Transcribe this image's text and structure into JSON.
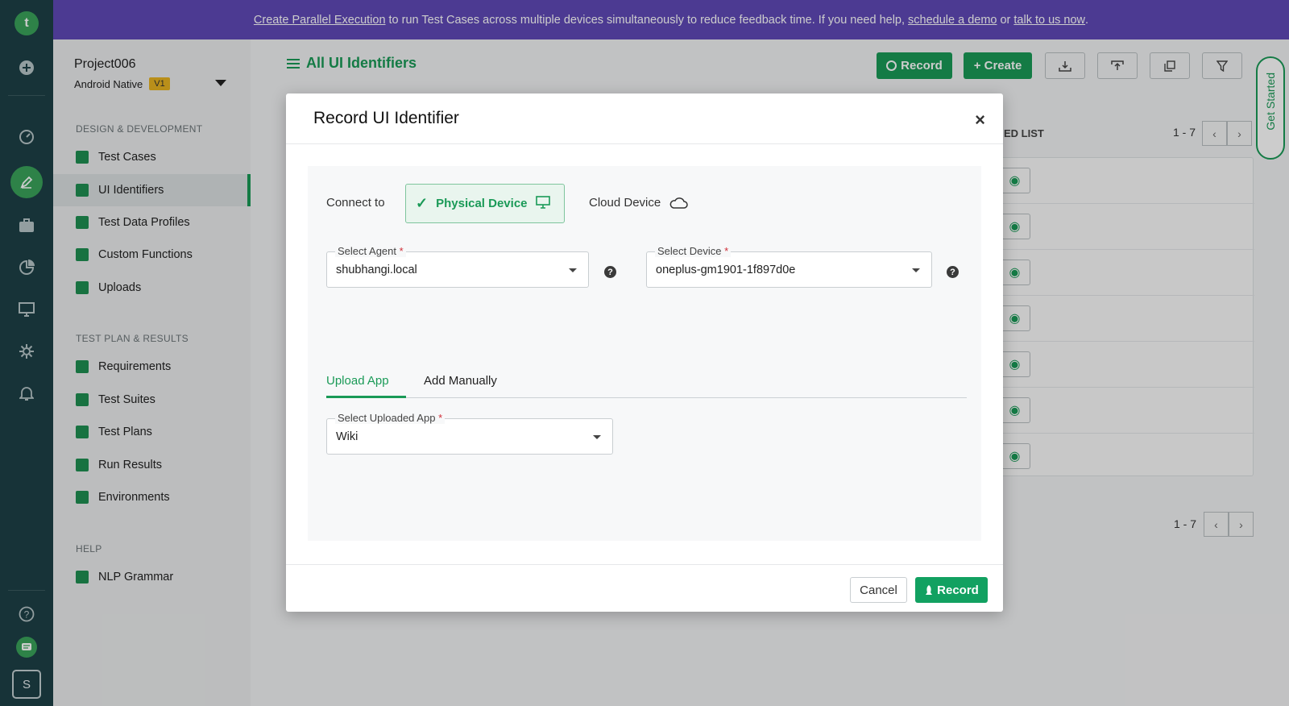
{
  "banner": {
    "link1": "Create Parallel Execution",
    "text1": "to run Test Cases across multiple devices simultaneously to reduce feedback time.  If you need help,",
    "link2": "schedule a demo",
    "text2": "or",
    "link3": "talk to us now",
    "text3": "."
  },
  "rail": {
    "avatar_letter": "S"
  },
  "project": {
    "name": "Project006",
    "app_type": "Android Native",
    "version": "V1"
  },
  "sidenav": {
    "section1": "DESIGN & DEVELOPMENT",
    "items1": [
      {
        "label": "Test Cases"
      },
      {
        "label": "UI Identifiers"
      },
      {
        "label": "Test Data Profiles"
      },
      {
        "label": "Custom Functions"
      },
      {
        "label": "Uploads"
      }
    ],
    "section2": "TEST PLAN & RESULTS",
    "items2": [
      {
        "label": "Requirements"
      },
      {
        "label": "Test Suites"
      },
      {
        "label": "Test Plans"
      },
      {
        "label": "Run Results"
      },
      {
        "label": "Environments"
      }
    ],
    "section3": "HELP",
    "items3": [
      {
        "label": "NLP Grammar"
      }
    ]
  },
  "main": {
    "title": "All UI Identifiers",
    "record_label": "Record",
    "create_label": "+ Create",
    "list_label": "ED LIST",
    "pagination_top": "1 - 7",
    "pagination_bottom": "1 - 7",
    "get_started": "Get Started"
  },
  "modal": {
    "title": "Record UI Identifier",
    "close": "×",
    "connect_to_label": "Connect to",
    "physical_device": "Physical Device",
    "cloud_device": "Cloud Device",
    "agent": {
      "label": "Select Agent",
      "required": "*",
      "value": "shubhangi.local"
    },
    "device": {
      "label": "Select Device",
      "required": "*",
      "value": "oneplus-gm1901-1f897d0e"
    },
    "tabs": [
      {
        "label": "Upload App"
      },
      {
        "label": "Add Manually"
      }
    ],
    "app": {
      "label": "Select Uploaded App",
      "required": "*",
      "value": "Wiki"
    },
    "cancel_label": "Cancel",
    "record_label": "Record"
  },
  "colors": {
    "accent": "#1a9a57",
    "banner": "#5f49b7",
    "rail": "#1d4046"
  }
}
